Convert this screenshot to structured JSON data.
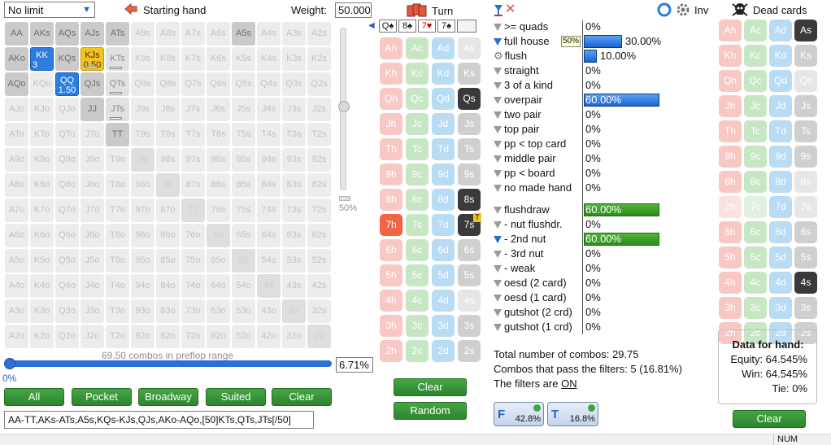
{
  "header": {
    "limit_select": "No limit",
    "starting_hand": "Starting hand",
    "weight_label": "Weight:",
    "weight_value": "50.000",
    "turn_label": "Turn",
    "inv_label": "Inv",
    "dead_cards_label": "Dead cards"
  },
  "range_grid": {
    "rows": [
      [
        "AA",
        "AKs",
        "AQs",
        "AJs",
        "ATs",
        "A9s",
        "A8s",
        "A7s",
        "A6s",
        "A5s",
        "A4s",
        "A3s",
        "A2s"
      ],
      [
        "AKo",
        "KK",
        "KQs",
        "KJs",
        "KTs",
        "K9s",
        "K8s",
        "K7s",
        "K6s",
        "K5s",
        "K4s",
        "K3s",
        "K2s"
      ],
      [
        "AQo",
        "KQo",
        "QQ",
        "QJs",
        "QTs",
        "Q9s",
        "Q8s",
        "Q7s",
        "Q6s",
        "Q5s",
        "Q4s",
        "Q3s",
        "Q2s"
      ],
      [
        "AJo",
        "KJo",
        "QJo",
        "JJ",
        "JTs",
        "J9s",
        "J8s",
        "J7s",
        "J6s",
        "J5s",
        "J4s",
        "J3s",
        "J2s"
      ],
      [
        "ATo",
        "KTo",
        "QTo",
        "JTo",
        "TT",
        "T9s",
        "T8s",
        "T7s",
        "T6s",
        "T5s",
        "T4s",
        "T3s",
        "T2s"
      ],
      [
        "A9o",
        "K9o",
        "Q9o",
        "J9o",
        "T9o",
        "99",
        "98s",
        "97s",
        "96s",
        "95s",
        "94s",
        "93s",
        "92s"
      ],
      [
        "A8o",
        "K8o",
        "Q8o",
        "J8o",
        "T8o",
        "98o",
        "88",
        "87s",
        "86s",
        "85s",
        "84s",
        "83s",
        "82s"
      ],
      [
        "A7o",
        "K7o",
        "Q7o",
        "J7o",
        "T7o",
        "97o",
        "87o",
        "77",
        "76s",
        "75s",
        "74s",
        "73s",
        "72s"
      ],
      [
        "A6o",
        "K6o",
        "Q6o",
        "J6o",
        "T6o",
        "96o",
        "86o",
        "76o",
        "66",
        "65s",
        "64s",
        "63s",
        "62s"
      ],
      [
        "A5o",
        "K5o",
        "Q5o",
        "J5o",
        "T5o",
        "95o",
        "85o",
        "75o",
        "65o",
        "55",
        "54s",
        "53s",
        "52s"
      ],
      [
        "A4o",
        "K4o",
        "Q4o",
        "J4o",
        "T4o",
        "94o",
        "84o",
        "74o",
        "64o",
        "54o",
        "44",
        "43s",
        "42s"
      ],
      [
        "A3o",
        "K3o",
        "Q3o",
        "J3o",
        "T3o",
        "93o",
        "83o",
        "73o",
        "63o",
        "53o",
        "43o",
        "33",
        "32s"
      ],
      [
        "A2o",
        "K2o",
        "Q2o",
        "J2o",
        "T2o",
        "92o",
        "82o",
        "72o",
        "62o",
        "52o",
        "42o",
        "32o",
        "22"
      ]
    ],
    "kk_count": "3",
    "kjs_weight": "0.50",
    "qq_count": "1.50",
    "slider_mark": "50%",
    "combos_text": "69.50 combos in preflop range",
    "range_pct": "6.71%",
    "range_slider": "0%"
  },
  "buttons": {
    "all": "All",
    "pocket": "Pocket",
    "broadway": "Broadway",
    "suited": "Suited",
    "clear": "Clear",
    "board_clear": "Clear",
    "board_random": "Random",
    "dead_clear": "Clear"
  },
  "range_text": "AA-TT,AKs-ATs,A5s,KQs-KJs,QJs,AKo-AQo,[50]KTs,QTs,JTs[/50]",
  "board": [
    "Q♠",
    "8♠",
    "7♥",
    "7♠",
    ""
  ],
  "card_ranks": [
    "A",
    "K",
    "Q",
    "J",
    "T",
    "9",
    "8",
    "7",
    "6",
    "5",
    "4",
    "3",
    "2"
  ],
  "suits": [
    "h",
    "c",
    "d",
    "s"
  ],
  "filters": [
    {
      "label": ">= quads",
      "value": "0%",
      "on": false
    },
    {
      "label": "full house",
      "value": "30.00%",
      "on": true,
      "bar": 0.3,
      "tag": "50%"
    },
    {
      "label": "flush",
      "value": "10.00%",
      "on": false,
      "bar": 0.1,
      "gear": true
    },
    {
      "label": "straight",
      "value": "0%",
      "on": false
    },
    {
      "label": "3 of a kind",
      "value": "0%",
      "on": false
    },
    {
      "label": "overpair",
      "value": "60.00%",
      "on": false,
      "bar": 0.6
    },
    {
      "label": "two pair",
      "value": "0%",
      "on": false
    },
    {
      "label": "top pair",
      "value": "0%",
      "on": false
    },
    {
      "label": "pp < top card",
      "value": "0%",
      "on": false
    },
    {
      "label": "middle pair",
      "value": "0%",
      "on": false
    },
    {
      "label": "pp < board",
      "value": "0%",
      "on": false
    },
    {
      "label": "no made hand",
      "value": "0%",
      "on": false
    },
    {
      "label": "flushdraw",
      "value": "60.00%",
      "on": false,
      "bar": 0.6,
      "green": true
    },
    {
      "label": "- nut flushdr.",
      "value": "0%",
      "on": false
    },
    {
      "label": "- 2nd nut",
      "value": "60.00%",
      "on": true,
      "bar": 0.6,
      "green": true
    },
    {
      "label": "- 3rd nut",
      "value": "0%",
      "on": false
    },
    {
      "label": "- weak",
      "value": "0%",
      "on": false
    },
    {
      "label": "oesd (2 card)",
      "value": "0%",
      "on": false
    },
    {
      "label": "oesd (1 card)",
      "value": "0%",
      "on": false
    },
    {
      "label": "gutshot (2 crd)",
      "value": "0%",
      "on": false
    },
    {
      "label": "gutshot (1 crd)",
      "value": "0%",
      "on": false
    }
  ],
  "summary": {
    "total": "Total number of combos: 29.75",
    "pass": "Combos that pass the filters: 5 (16.81%)",
    "filters_prefix": "The filters are ",
    "filters_state": "ON"
  },
  "badges": {
    "f_pct": "42.8%",
    "t_pct": "16.8%",
    "f_label": "F",
    "t_label": "T"
  },
  "hand_data": {
    "title": "Data for hand:",
    "equity": "Equity: 64.545%",
    "win": "Win: 64.545%",
    "tie": "Tie: 0%"
  },
  "status": {
    "num": "NUM"
  }
}
